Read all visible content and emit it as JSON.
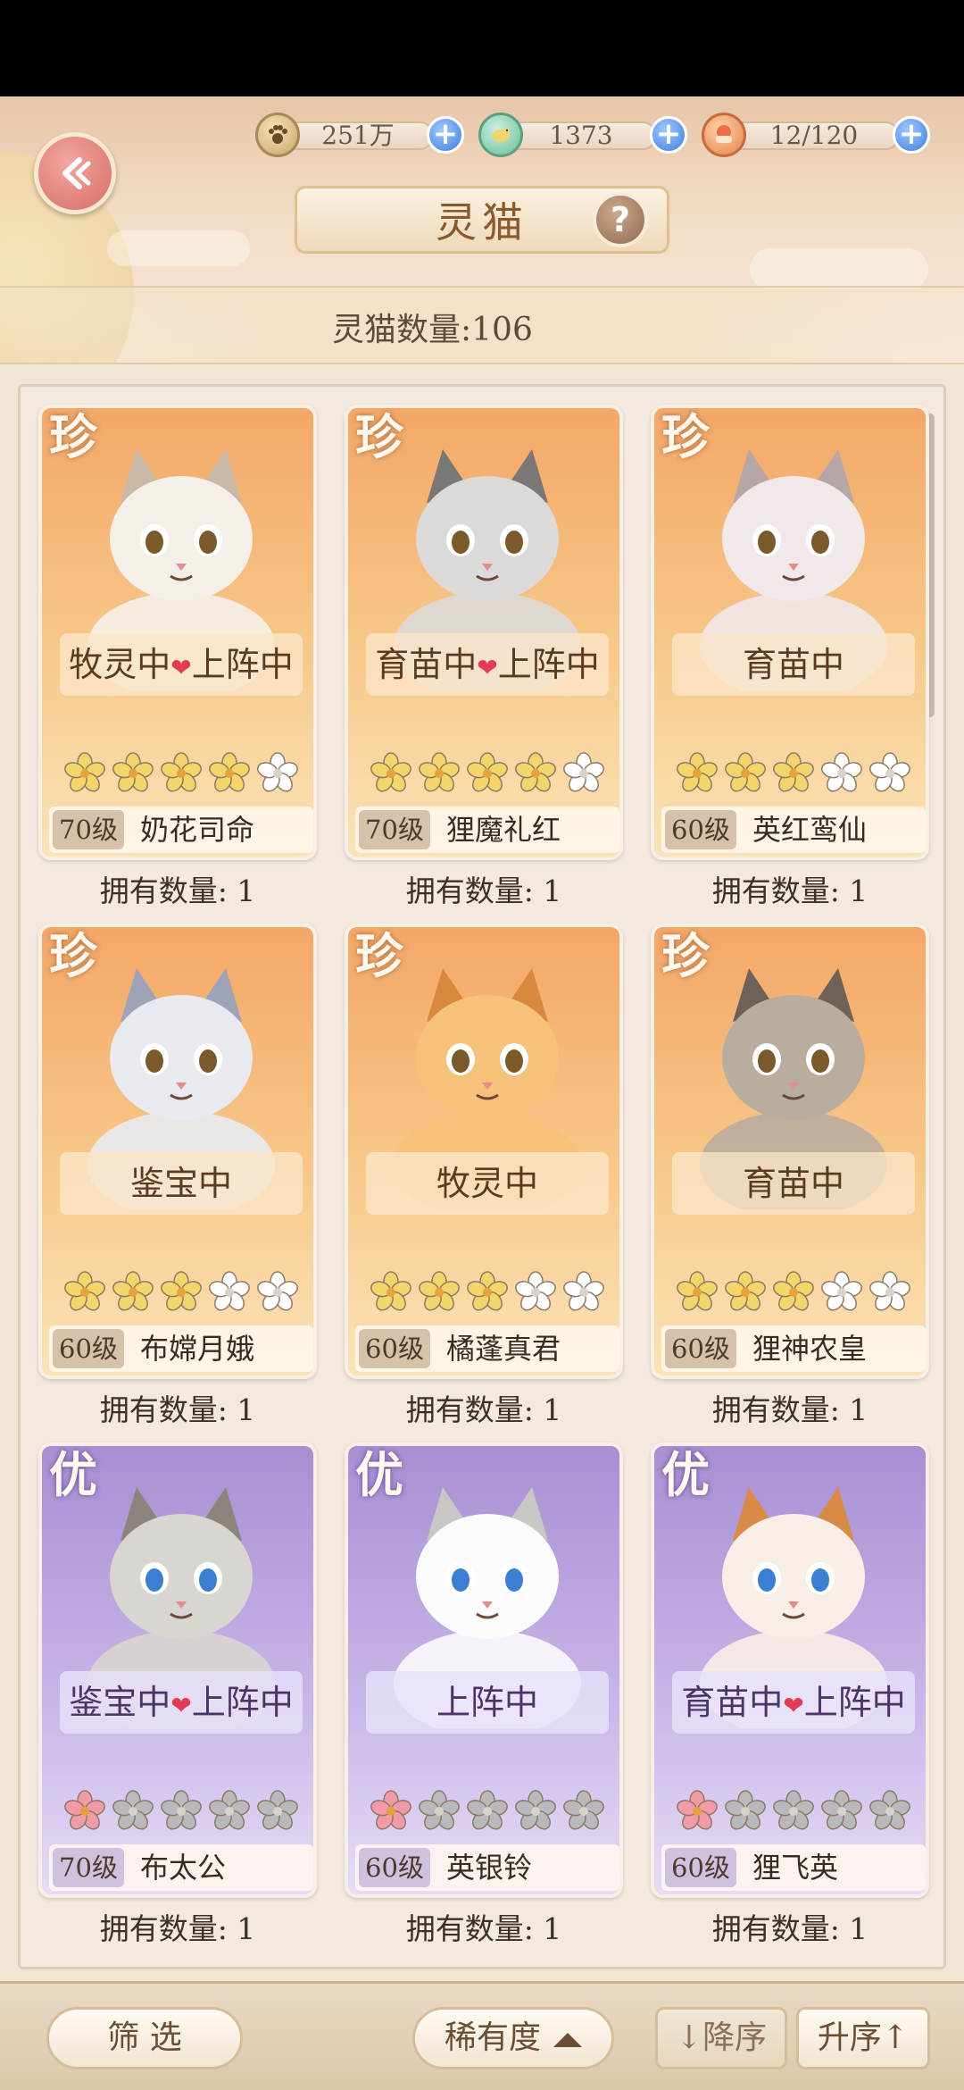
{
  "header": {
    "title": "灵猫",
    "help_label": "?",
    "cat_count_text": "灵猫数量:106"
  },
  "resources": [
    {
      "icon": "paw-coin-icon",
      "value": "251万"
    },
    {
      "icon": "bird-feather-icon",
      "value": "1373"
    },
    {
      "icon": "food-bowl-icon",
      "value": "12/120"
    }
  ],
  "cards": [
    {
      "rarity": "珍",
      "status": "牧灵中",
      "status2": "上阵中",
      "level": "70级",
      "name": "奶花司命",
      "stars_filled": 4,
      "owned": "拥有数量: 1"
    },
    {
      "rarity": "珍",
      "status": "育苗中",
      "status2": "上阵中",
      "level": "70级",
      "name": "狸魔礼红",
      "stars_filled": 4,
      "owned": "拥有数量: 1"
    },
    {
      "rarity": "珍",
      "status": "育苗中",
      "status2": "",
      "level": "60级",
      "name": "英红鸾仙",
      "stars_filled": 3,
      "owned": "拥有数量: 1"
    },
    {
      "rarity": "珍",
      "status": "鉴宝中",
      "status2": "",
      "level": "60级",
      "name": "布嫦月娥",
      "stars_filled": 3,
      "owned": "拥有数量: 1"
    },
    {
      "rarity": "珍",
      "status": "牧灵中",
      "status2": "",
      "level": "60级",
      "name": "橘蓬真君",
      "stars_filled": 3,
      "owned": "拥有数量: 1"
    },
    {
      "rarity": "珍",
      "status": "育苗中",
      "status2": "",
      "level": "60级",
      "name": "狸神农皇",
      "stars_filled": 3,
      "owned": "拥有数量: 1"
    },
    {
      "rarity": "优",
      "status": "鉴宝中",
      "status2": "上阵中",
      "level": "70级",
      "name": "布太公",
      "stars_filled": 1,
      "owned": "拥有数量: 1"
    },
    {
      "rarity": "优",
      "status": "上阵中",
      "status2": "",
      "level": "60级",
      "name": "英银铃",
      "stars_filled": 1,
      "owned": "拥有数量: 1"
    },
    {
      "rarity": "优",
      "status": "育苗中",
      "status2": "上阵中",
      "level": "60级",
      "name": "狸飞英",
      "stars_filled": 1,
      "owned": "拥有数量: 1"
    }
  ],
  "footer": {
    "filter_label": "筛 选",
    "sort_field_label": "稀有度",
    "desc_label": "↓降序",
    "asc_label": "升序↑"
  },
  "colors": {
    "zhen_card": "#f3a768",
    "you_card": "#a88fd2",
    "star_gold": "#f3d56a",
    "star_white": "#ffffff",
    "star_pink": "#f39aa8",
    "star_grey": "#b9b9bd"
  }
}
